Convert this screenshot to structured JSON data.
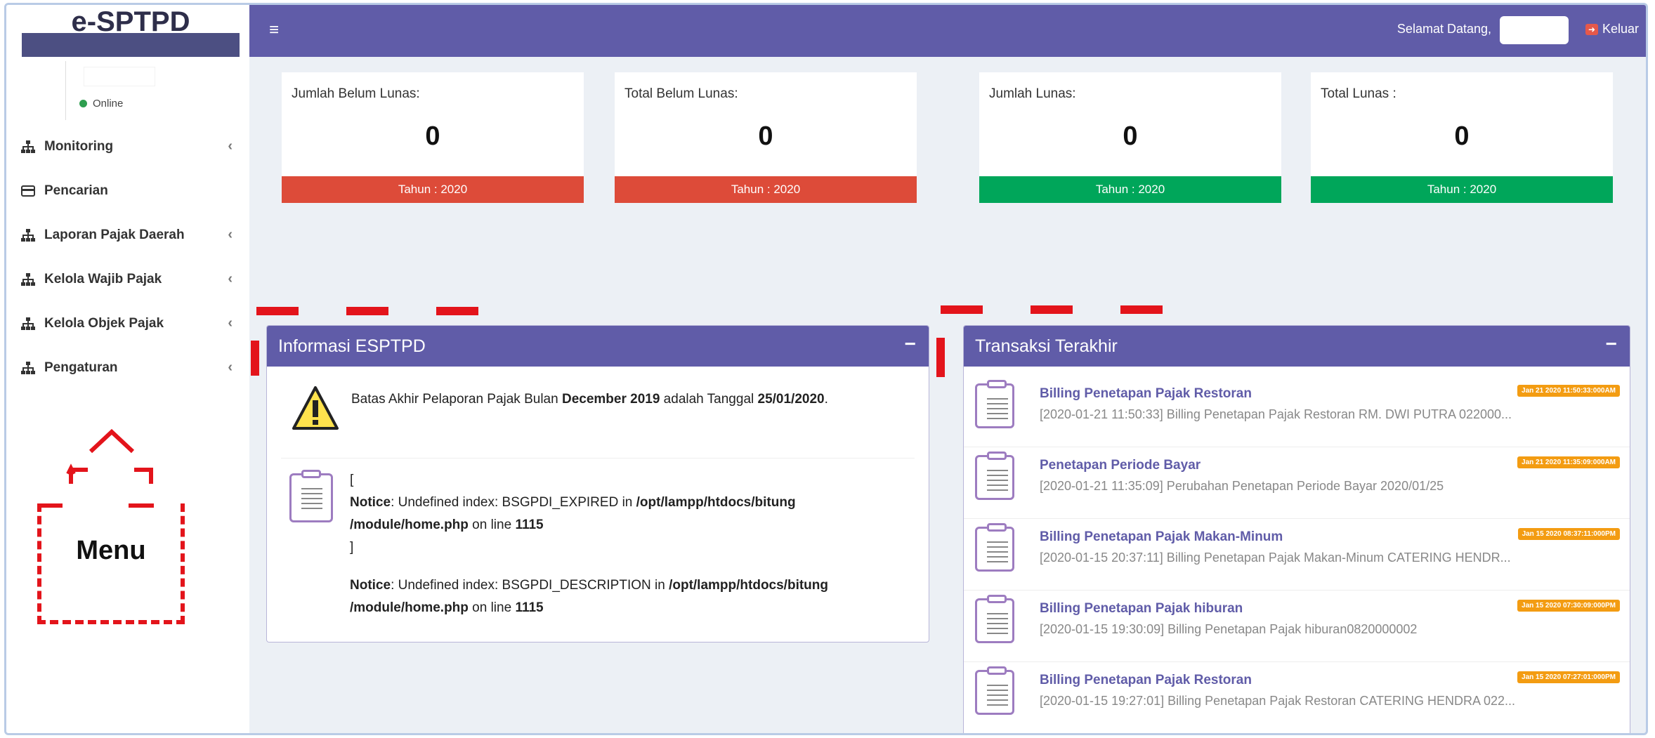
{
  "app": {
    "logo": "e-SPTPD"
  },
  "user": {
    "status": "Online"
  },
  "sidebar": {
    "items": [
      {
        "label": "Monitoring",
        "icon": "sitemap-icon"
      },
      {
        "label": "Pencarian",
        "icon": "credit-card-icon"
      },
      {
        "label": "Laporan Pajak Daerah",
        "icon": "sitemap-icon"
      },
      {
        "label": "Kelola Wajib Pajak",
        "icon": "sitemap-icon"
      },
      {
        "label": "Kelola Objek Pajak",
        "icon": "sitemap-icon"
      },
      {
        "label": "Pengaturan",
        "icon": "sitemap-icon"
      }
    ]
  },
  "annotation": {
    "menu_label": "Menu"
  },
  "header": {
    "welcome": "Selamat Datang,",
    "logout": "Keluar"
  },
  "stats": [
    {
      "label": "Jumlah Belum Lunas:",
      "value": "0",
      "footer": "Tahun : 2020",
      "color": "#dd4b39"
    },
    {
      "label": "Total Belum Lunas:",
      "value": "0",
      "footer": "Tahun : 2020",
      "color": "#dd4b39"
    },
    {
      "label": "Jumlah Lunas:",
      "value": "0",
      "footer": "Tahun : 2020",
      "color": "#00a65a"
    },
    {
      "label": "Total Lunas :",
      "value": "0",
      "footer": "Tahun : 2020",
      "color": "#00a65a"
    }
  ],
  "info": {
    "title": "Informasi ESPTPD",
    "minimize": "−",
    "deadline_pre": "Batas Akhir Pelaporan Pajak Bulan ",
    "deadline_month": "December 2019",
    "deadline_mid": " adalah Tanggal ",
    "deadline_date": "25/01/2020",
    "deadline_end": ".",
    "open_bracket": "[",
    "close_bracket": "]",
    "notice_label": "Notice",
    "notice1_text": ": Undefined index: BSGPDI_EXPIRED in ",
    "notice1_path": "/opt/lampp/htdocs/bitung /module/home.php",
    "notice1_line_text": " on line ",
    "notice1_line": "1115",
    "notice2_text": ": Undefined index: BSGPDI_DESCRIPTION in ",
    "notice2_path": "/opt/lampp/htdocs/bitung /module/home.php",
    "notice2_line_text": " on line ",
    "notice2_line": "1115"
  },
  "transaksi": {
    "title": "Transaksi Terakhir",
    "minimize": "−",
    "items": [
      {
        "title": "Billing Penetapan Pajak Restoran",
        "badge": "Jan 21 2020 11:50:33:000AM",
        "desc": "[2020-01-21 11:50:33] Billing Penetapan Pajak Restoran RM. DWI PUTRA 022000..."
      },
      {
        "title": "Penetapan Periode Bayar",
        "badge": "Jan 21 2020 11:35:09:000AM",
        "desc": "[2020-01-21 11:35:09] Perubahan Penetapan Periode Bayar 2020/01/25"
      },
      {
        "title": "Billing Penetapan Pajak Makan-Minum",
        "badge": "Jan 15 2020 08:37:11:000PM",
        "desc": "[2020-01-15 20:37:11] Billing Penetapan Pajak Makan-Minum CATERING HENDR..."
      },
      {
        "title": "Billing Penetapan Pajak hiburan",
        "badge": "Jan 15 2020 07:30:09:000PM",
        "desc": "[2020-01-15 19:30:09] Billing Penetapan Pajak hiburan0820000002"
      },
      {
        "title": "Billing Penetapan Pajak Restoran",
        "badge": "Jan 15 2020 07:27:01:000PM",
        "desc": "[2020-01-15 19:27:01] Billing Penetapan Pajak Restoran CATERING HENDRA 022..."
      }
    ]
  }
}
